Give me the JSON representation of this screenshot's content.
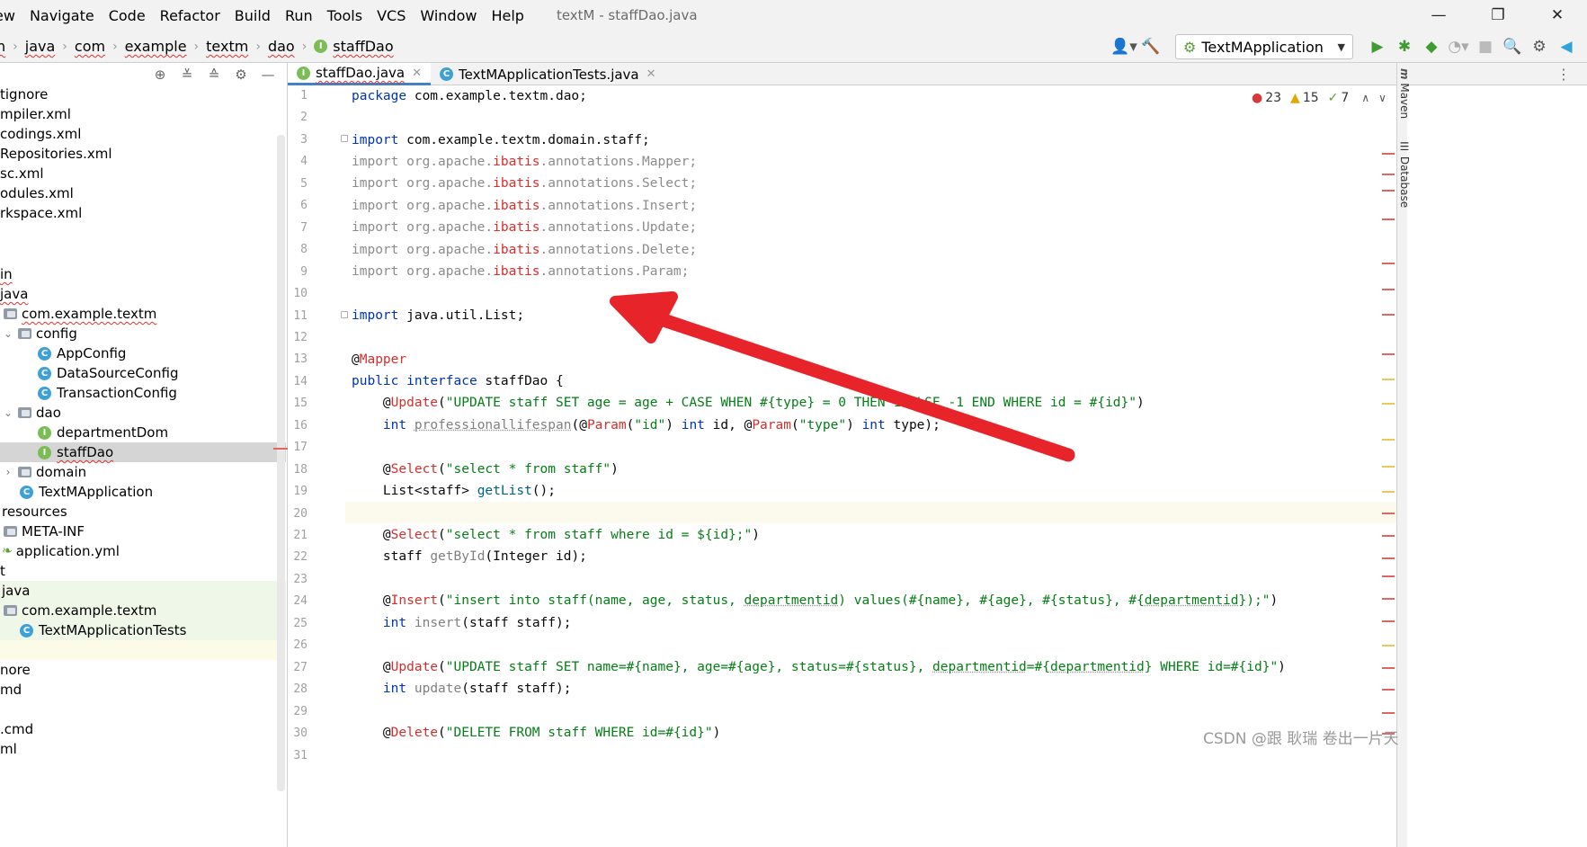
{
  "menu": {
    "items": [
      "ew",
      "Navigate",
      "Code",
      "Refactor",
      "Build",
      "Run",
      "Tools",
      "VCS",
      "Window",
      "Help"
    ],
    "window_title": "textM - staffDao.java"
  },
  "window_controls": {
    "minimize": "—",
    "restore": "❐",
    "close": "✕"
  },
  "breadcrumb": {
    "items": [
      "n",
      "java",
      "com",
      "example",
      "textm",
      "dao",
      "staffDao"
    ],
    "interface_badge": "I"
  },
  "toolbar": {
    "run_config": "TextMApplication",
    "icons": [
      "user-icon",
      "hammer-icon",
      "run-icon",
      "debug-icon",
      "coverage-icon",
      "profile-icon",
      "stop-icon",
      "search-icon",
      "settings-icon",
      "jetbrains-icon"
    ]
  },
  "project_tree": {
    "header_icons": [
      "locate-icon",
      "expand-all-icon",
      "collapse-all-icon",
      "settings-icon",
      "hide-icon"
    ],
    "rows": [
      {
        "text": "tignore"
      },
      {
        "text": "mpiler.xml"
      },
      {
        "text": "codings.xml"
      },
      {
        "text": "Repositories.xml"
      },
      {
        "text": "sc.xml"
      },
      {
        "text": "odules.xml"
      },
      {
        "text": "rkspace.xml"
      },
      {
        "text": ""
      },
      {
        "text": ""
      },
      {
        "text": "in"
      },
      {
        "text": "java"
      },
      {
        "text": "com.example.textm"
      },
      {
        "text": "config"
      },
      {
        "text": "AppConfig"
      },
      {
        "text": "DataSourceConfig"
      },
      {
        "text": "TransactionConfig"
      },
      {
        "text": "dao"
      },
      {
        "text": "departmentDom"
      },
      {
        "text": "staffDao"
      },
      {
        "text": "domain"
      },
      {
        "text": "TextMApplication"
      },
      {
        "text": "resources"
      },
      {
        "text": "META-INF"
      },
      {
        "text": "application.yml"
      },
      {
        "text": "t"
      },
      {
        "text": "java"
      },
      {
        "text": "com.example.textm"
      },
      {
        "text": "TextMApplicationTests"
      },
      {
        "text": ""
      },
      {
        "text": "nore"
      },
      {
        "text": "md"
      },
      {
        "text": ""
      },
      {
        "text": ".cmd"
      },
      {
        "text": "ml"
      }
    ],
    "badges": {
      "class": "C",
      "interface": "I"
    }
  },
  "tabs": [
    {
      "label": "staffDao.java",
      "badge": "I"
    },
    {
      "label": "TextMApplicationTests.java",
      "badge": "C"
    }
  ],
  "tab_menu": "⋮",
  "inspections": {
    "errors": "23",
    "warnings": "15",
    "weak": "7"
  },
  "side_labels": {
    "maven": "Maven",
    "database": "Database"
  },
  "editor": {
    "caret_line": 20,
    "line_numbers": [
      "1",
      "2",
      "3",
      "4",
      "5",
      "6",
      "7",
      "8",
      "9",
      "10",
      "11",
      "12",
      "13",
      "14",
      "15",
      "16",
      "17",
      "18",
      "19",
      "20",
      "21",
      "22",
      "23",
      "24",
      "25",
      "26",
      "27",
      "28",
      "29",
      "30",
      "31"
    ],
    "lines": {
      "l1": [
        "package",
        " com.example.textm.dao;"
      ],
      "l3": [
        "import",
        " com.example.textm.domain.staff;"
      ],
      "l4": [
        "import org.apache.",
        "ibatis",
        ".annotations.Mapper;"
      ],
      "l5": [
        "import org.apache.",
        "ibatis",
        ".annotations.Select;"
      ],
      "l6": [
        "import org.apache.",
        "ibatis",
        ".annotations.Insert;"
      ],
      "l7": [
        "import org.apache.",
        "ibatis",
        ".annotations.Update;"
      ],
      "l8": [
        "import org.apache.",
        "ibatis",
        ".annotations.Delete;"
      ],
      "l9": [
        "import org.apache.",
        "ibatis",
        ".annotations.Param;"
      ],
      "l11": [
        "import",
        " java.util.List;"
      ],
      "l13": [
        "@",
        "Mapper"
      ],
      "l14": [
        "public",
        " ",
        "interface",
        " staffDao {"
      ],
      "l15": [
        "    @",
        "Update",
        "(",
        "\"UPDATE staff SET age = age + CASE WHEN #{type} = 0 THEN 1 ELSE -1 END WHERE id = #{id}\"",
        ")"
      ],
      "l16": [
        "    ",
        "int",
        " ",
        "professionallifespan",
        "(@",
        "Param",
        "(",
        "\"id\"",
        ") ",
        "int",
        " id, @",
        "Param",
        "(",
        "\"type\"",
        ") ",
        "int",
        " type);"
      ],
      "l18": [
        "    @",
        "Select",
        "(",
        "\"select * from staff\"",
        ")"
      ],
      "l19": [
        "    List<staff> ",
        "getList",
        "();"
      ],
      "l21": [
        "    @",
        "Select",
        "(",
        "\"select * from staff where id = ${id};\"",
        ")"
      ],
      "l22": [
        "    staff ",
        "getById",
        "(Integer id);"
      ],
      "l24": [
        "    @",
        "Insert",
        "(",
        "\"insert into staff(name, age, status, ",
        "departmentid",
        ") values(#{name}, #{age}, #{status}, #{",
        "departmentid",
        "});\"",
        ")"
      ],
      "l25": [
        "    ",
        "int",
        " ",
        "insert",
        "(staff staff);"
      ],
      "l27": [
        "    @",
        "Update",
        "(",
        "\"UPDATE staff SET name=#{name}, age=#{age}, status=#{status}, ",
        "departmentid",
        "=#{",
        "departmentid",
        "} WHERE id=#{id}\"",
        ")"
      ],
      "l28": [
        "    ",
        "int",
        " ",
        "update",
        "(staff staff);"
      ],
      "l30": [
        "    @",
        "Delete",
        "(",
        "\"DELETE FROM staff WHERE id=#{id}\"",
        ")"
      ]
    }
  },
  "colors": {
    "keyword": "#0033b3",
    "string": "#067d17",
    "annotation": "#d32f2f",
    "unresolved": "#e22b2b",
    "arrow": "#e8242b",
    "selection": "#d5d5d5"
  },
  "watermark": "CSDN @跟 耿瑞 卷出一片天"
}
